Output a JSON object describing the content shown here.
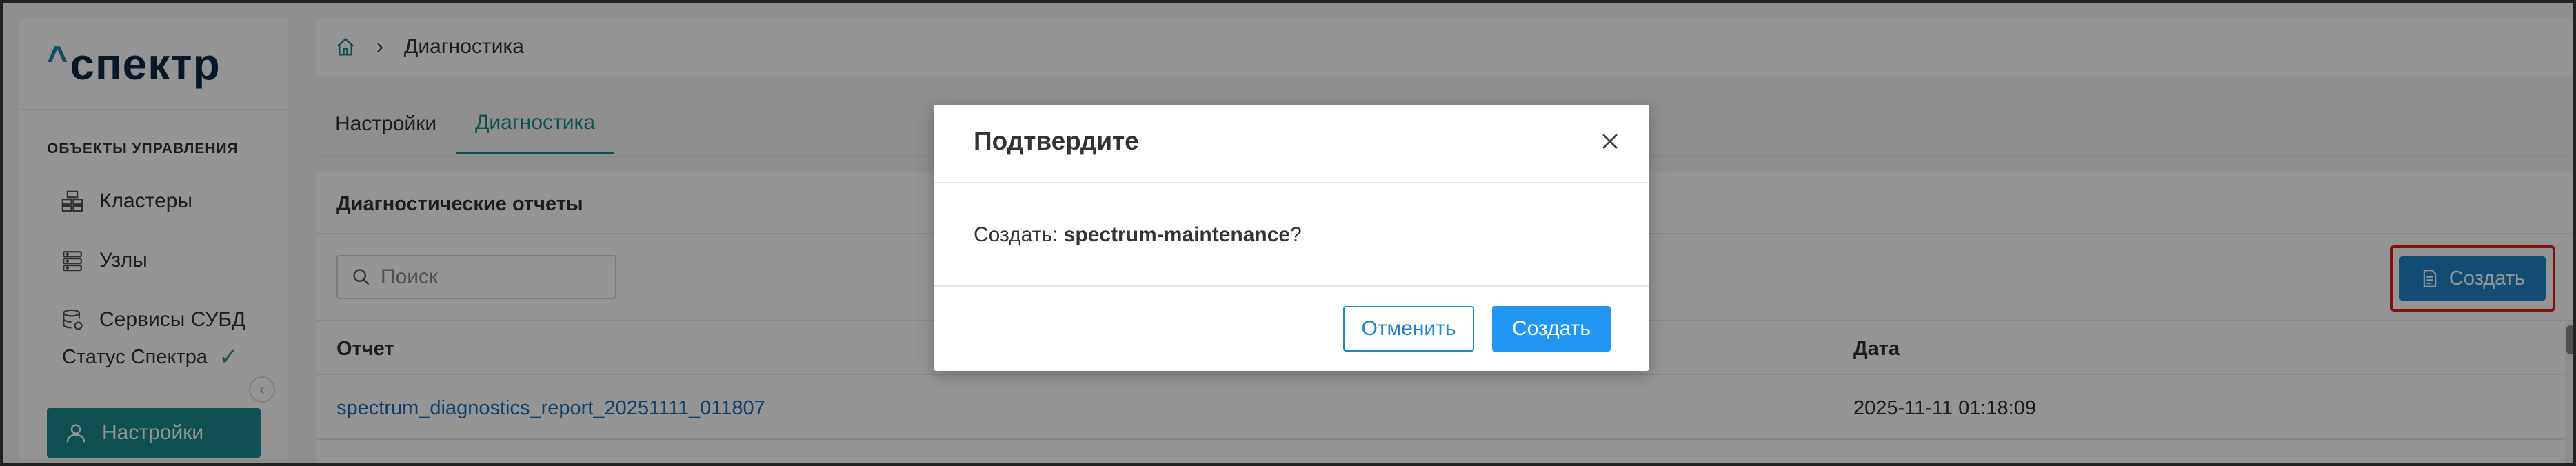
{
  "sidebar": {
    "logo": "спектр",
    "section_title": "ОБЪЕКТЫ УПРАВЛЕНИЯ",
    "items": [
      {
        "label": "Кластеры",
        "icon": "cluster-icon"
      },
      {
        "label": "Узлы",
        "icon": "server-icon"
      },
      {
        "label": "Сервисы СУБД",
        "icon": "database-icon"
      }
    ],
    "status_label": "Статус Спектра",
    "settings_label": "Настройки"
  },
  "breadcrumb": {
    "home_icon": "home-icon",
    "current": "Диагностика"
  },
  "tabs": [
    {
      "label": "Настройки",
      "active": false
    },
    {
      "label": "Диагностика",
      "active": true
    }
  ],
  "reports": {
    "title": "Диагностические отчеты",
    "search_placeholder": "Поиск",
    "create_label": "Создать",
    "columns": {
      "report": "Отчет",
      "date": "Дата"
    },
    "rows": [
      {
        "report": "spectrum_diagnostics_report_20251111_011807",
        "date": "2025-11-11 01:18:09"
      }
    ]
  },
  "modal": {
    "title": "Подтвердите",
    "body_prefix": "Создать: ",
    "body_target": "spectrum-maintenance",
    "body_suffix": "?",
    "cancel_label": "Отменить",
    "confirm_label": "Создать"
  },
  "colors": {
    "accent": "#1b8a8a",
    "primary_button": "#2196f3",
    "highlight_border": "#e02020"
  }
}
